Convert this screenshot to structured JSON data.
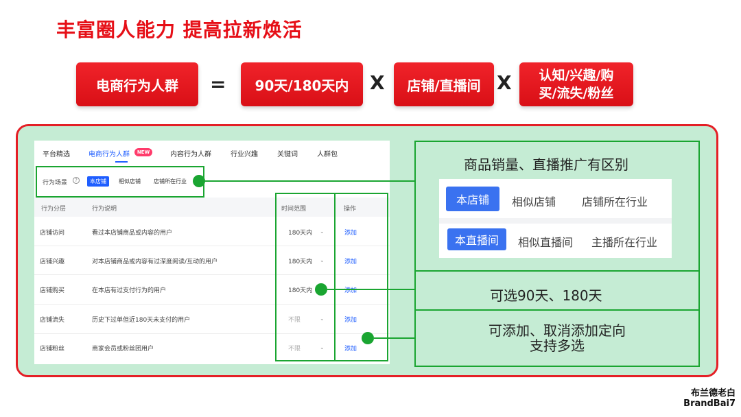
{
  "title": "丰富圈人能力 提高拉新焕活",
  "formula": {
    "lhs": "电商行为人群",
    "equals": "=",
    "term1": "90天/180天内",
    "times1": "X",
    "term2": "店铺/直播间",
    "times2": "X",
    "term3_line1": "认知/兴趣/购",
    "term3_line2": "买/流失/粉丝"
  },
  "ui": {
    "tabs": [
      "平台精选",
      "电商行为人群",
      "内容行为人群",
      "行业兴趣",
      "关键词",
      "人群包"
    ],
    "new_badge": "NEW",
    "scene_label": "行为场景",
    "help_icon": "?",
    "scene_chips": [
      "本店铺",
      "相似店铺",
      "店铺所在行业"
    ],
    "columns": [
      "行为分层",
      "行为说明",
      "时间范围",
      "操作"
    ],
    "rows": [
      {
        "layer": "店铺访问",
        "desc": "看过本店铺商品或内容的用户",
        "time": "180天内",
        "action": "添加"
      },
      {
        "layer": "店铺兴趣",
        "desc": "对本店铺商品或内容有过深度阅读/互动的用户",
        "time": "180天内",
        "action": "添加"
      },
      {
        "layer": "店铺购买",
        "desc": "在本店有过支付行为的用户",
        "time": "180天内",
        "action": "添加"
      },
      {
        "layer": "店铺流失",
        "desc": "历史下过单但近180天未支付的用户",
        "time": "不限",
        "action": "添加"
      },
      {
        "layer": "店铺粉丝",
        "desc": "商家会员或粉丝团用户",
        "time": "不限",
        "action": "添加"
      }
    ]
  },
  "features": {
    "f1_title": "商品销量、直播推广有区别",
    "shop_chips": [
      "本店铺",
      "相似店铺",
      "店铺所在行业"
    ],
    "live_chips": [
      "本直播间",
      "相似直播间",
      "主播所在行业"
    ],
    "f2_title": "可选90天、180天",
    "f3_line1": "可添加、取消添加定向",
    "f3_line2": "支持多选"
  },
  "logo": {
    "line1": "布兰德老白",
    "line2": "BrandBai7"
  },
  "colors": {
    "accent_red": "#e60f17",
    "panel_green": "#c5ecd4",
    "marker_green": "#1aa531",
    "ui_blue": "#1f5eff"
  }
}
